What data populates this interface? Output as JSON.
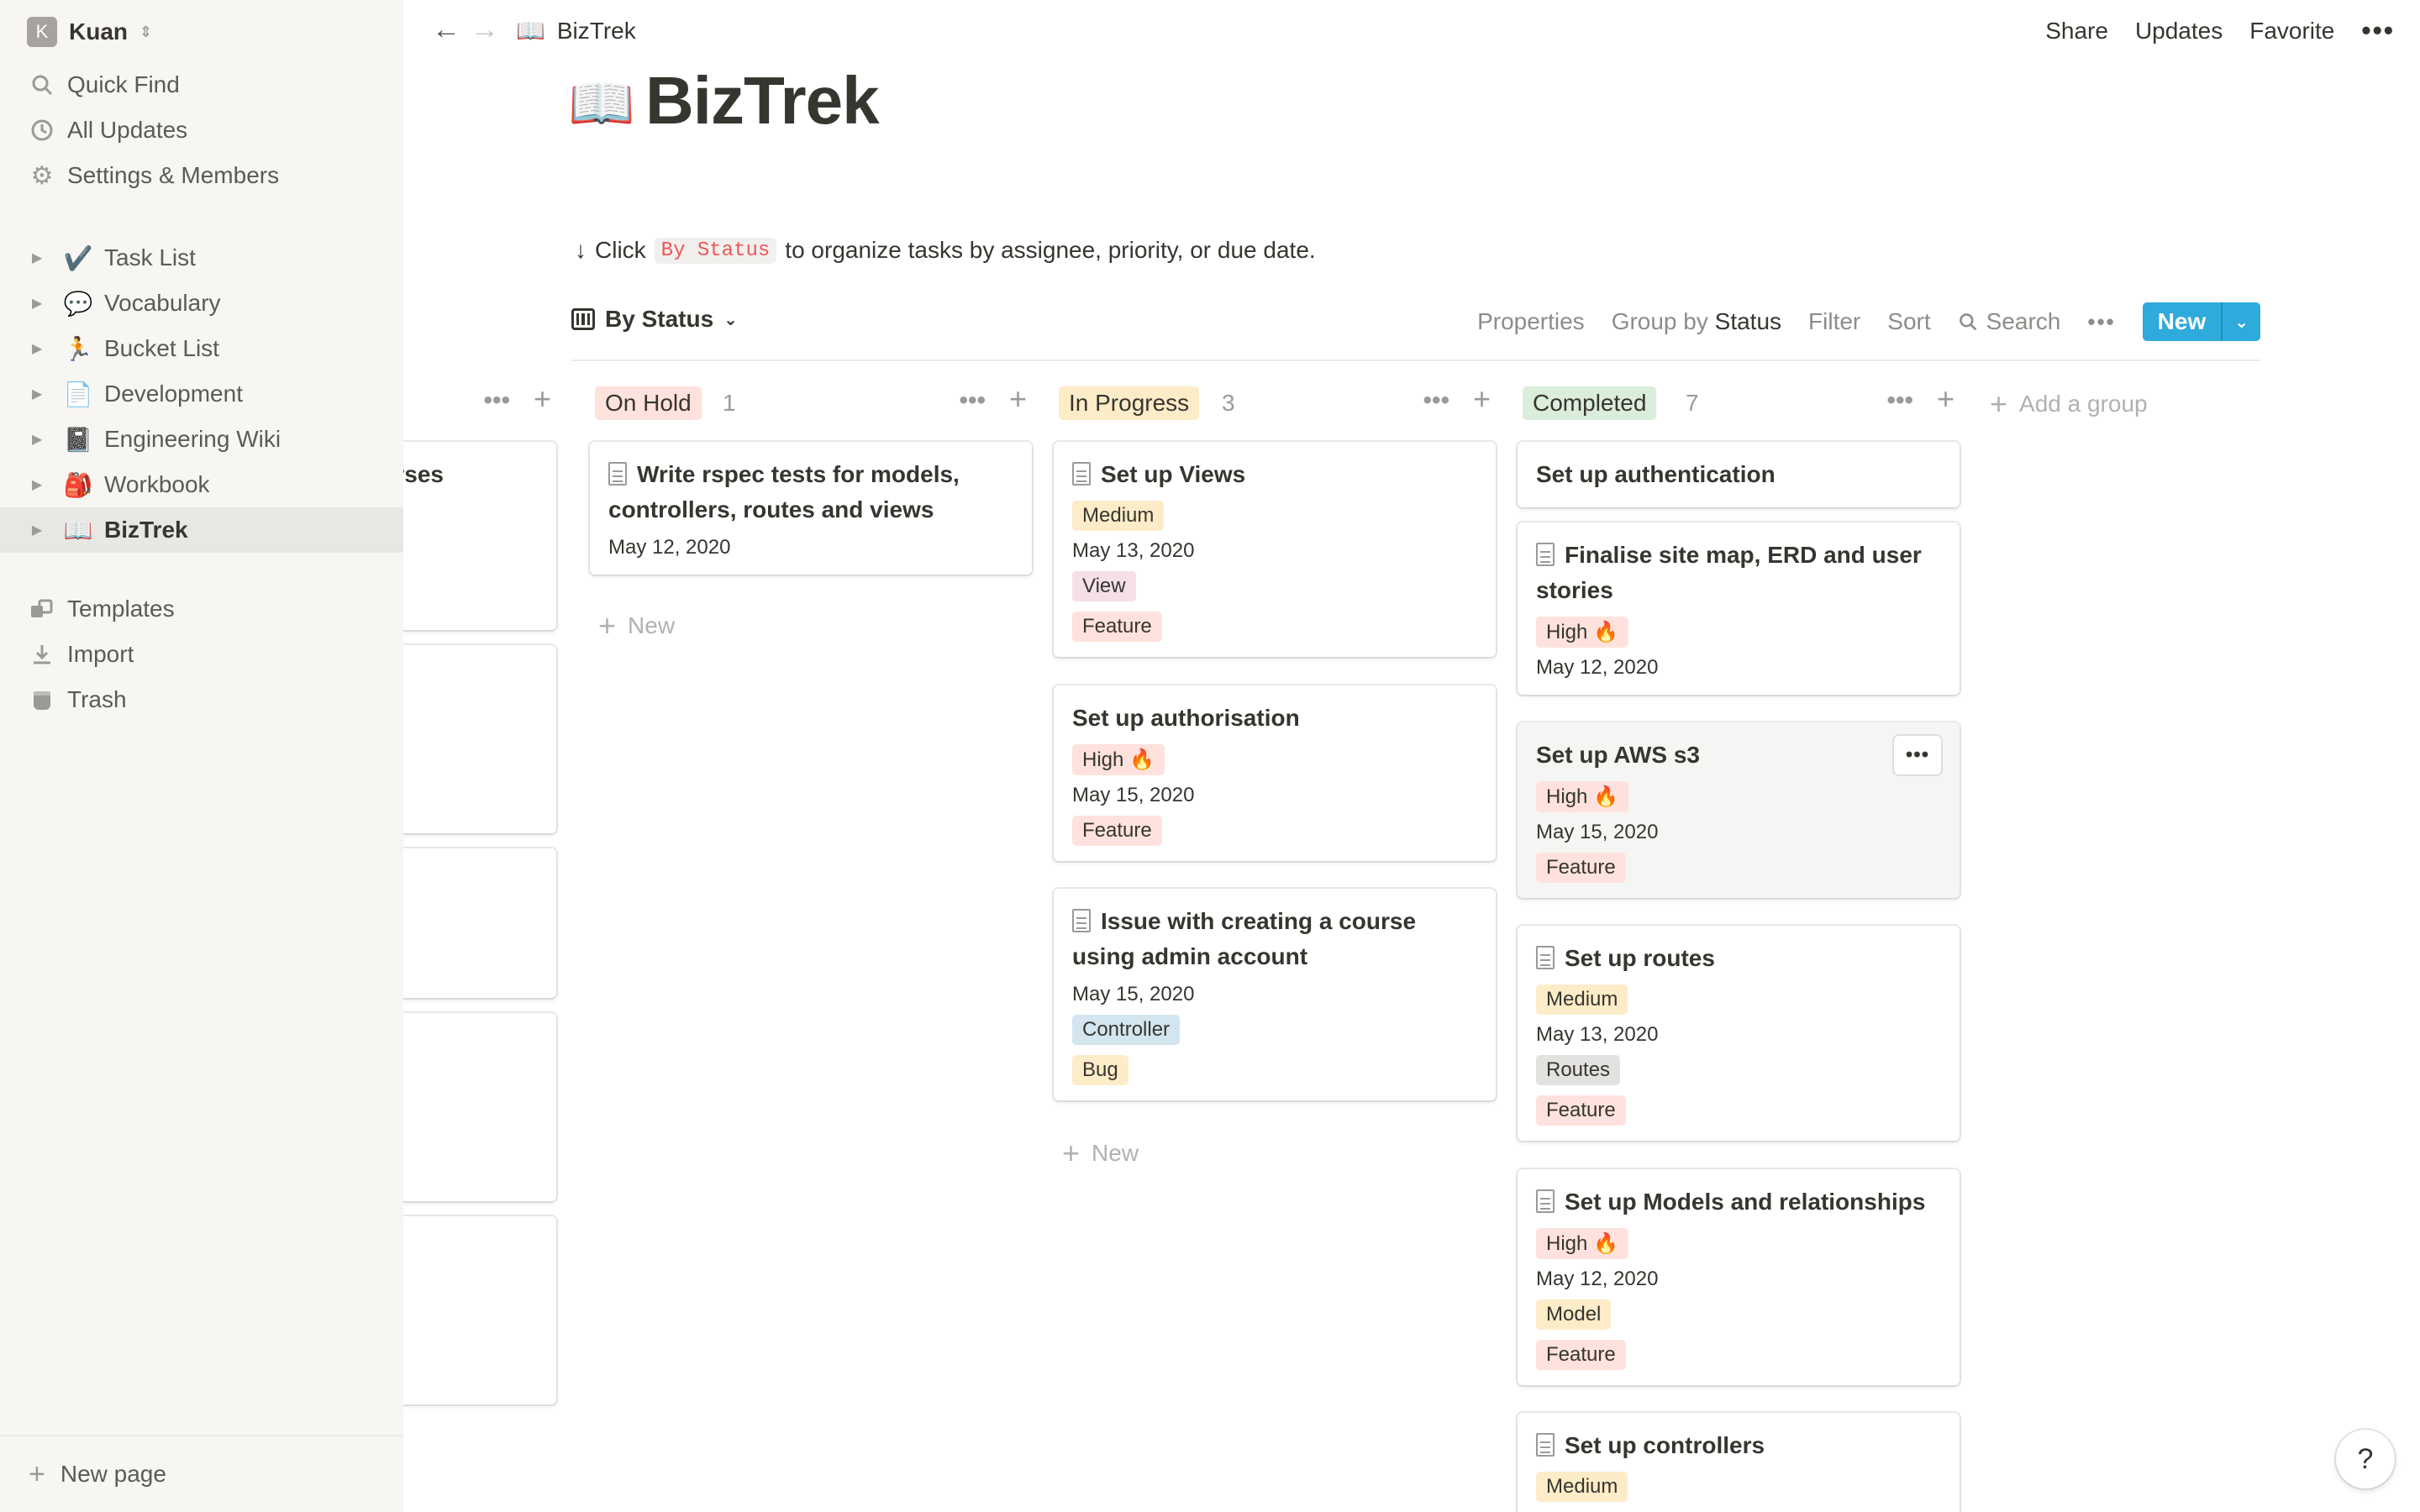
{
  "workspace": {
    "initial": "K",
    "name": "Kuan"
  },
  "sidebar": {
    "nav": [
      {
        "icon": "search-icon",
        "label": "Quick Find"
      },
      {
        "icon": "clock-icon",
        "label": "All Updates"
      },
      {
        "icon": "gear-icon",
        "label": "Settings & Members"
      }
    ],
    "pages": [
      {
        "emoji": "✔️",
        "label": "Task List"
      },
      {
        "emoji": "💬",
        "label": "Vocabulary"
      },
      {
        "emoji": "🏃",
        "label": "Bucket List"
      },
      {
        "emoji": "📄",
        "label": "Development"
      },
      {
        "emoji": "📓",
        "label": "Engineering Wiki"
      },
      {
        "emoji": "🎒",
        "label": "Workbook"
      },
      {
        "emoji": "📖",
        "label": "BizTrek"
      }
    ],
    "tools": [
      {
        "icon": "templates-icon",
        "label": "Templates"
      },
      {
        "icon": "import-icon",
        "label": "Import"
      },
      {
        "icon": "trash-icon",
        "label": "Trash"
      }
    ],
    "new_page": "New page"
  },
  "topbar": {
    "breadcrumb_emoji": "📖",
    "breadcrumb": "BizTrek",
    "share": "Share",
    "updates": "Updates",
    "favorite": "Favorite",
    "more": "•••"
  },
  "page": {
    "icon": "📖",
    "title": "BizTrek",
    "hint_arrow": "↓",
    "hint_pre": "Click",
    "hint_code": "By Status",
    "hint_post": "to organize tasks by assignee, priority, or due date."
  },
  "view": {
    "name": "By Status",
    "properties": "Properties",
    "group_by": "Group by",
    "group_by_value": "Status",
    "filter": "Filter",
    "sort": "Sort",
    "search": "Search",
    "more": "•••",
    "new": "New"
  },
  "board": {
    "first_col": {
      "partial_title": "rses"
    },
    "on_hold": {
      "label": "On Hold",
      "count": "1",
      "color": "#ffe2dd",
      "cards": [
        {
          "title": "Write rspec tests for models, controllers, routes and views",
          "date": "May 12, 2020"
        }
      ],
      "new": "New"
    },
    "in_progress": {
      "label": "In Progress",
      "count": "3",
      "color": "#fdecc8",
      "cards": [
        {
          "title": "Set up Views",
          "priority": "Medium",
          "date": "May 13, 2020",
          "tag1": "View",
          "tag2": "Feature"
        },
        {
          "title": "Set up authorisation",
          "priority": "High 🔥",
          "date": "May 15, 2020",
          "tag1": "Feature"
        },
        {
          "title": "Issue with creating a course using admin account",
          "date": "May 15, 2020",
          "tag1": "Controller",
          "tag2": "Bug"
        }
      ],
      "new": "New"
    },
    "completed": {
      "label": "Completed",
      "count": "7",
      "color": "#dbeddb",
      "cards": [
        {
          "title": "Set up authentication"
        },
        {
          "title": "Finalise site map, ERD and user stories",
          "priority": "High 🔥",
          "date": "May 12, 2020"
        },
        {
          "title": "Set up AWS s3",
          "priority": "High 🔥",
          "date": "May 15, 2020",
          "tag1": "Feature",
          "more": "•••"
        },
        {
          "title": "Set up routes",
          "priority": "Medium",
          "date": "May 13, 2020",
          "tag1": "Routes",
          "tag2": "Feature"
        },
        {
          "title": "Set up Models and relationships",
          "priority": "High 🔥",
          "date": "May 12, 2020",
          "tag1": "Model",
          "tag2": "Feature"
        },
        {
          "title": "Set up controllers",
          "priority": "Medium"
        }
      ]
    },
    "add_group": "Add a group"
  },
  "help": "?"
}
